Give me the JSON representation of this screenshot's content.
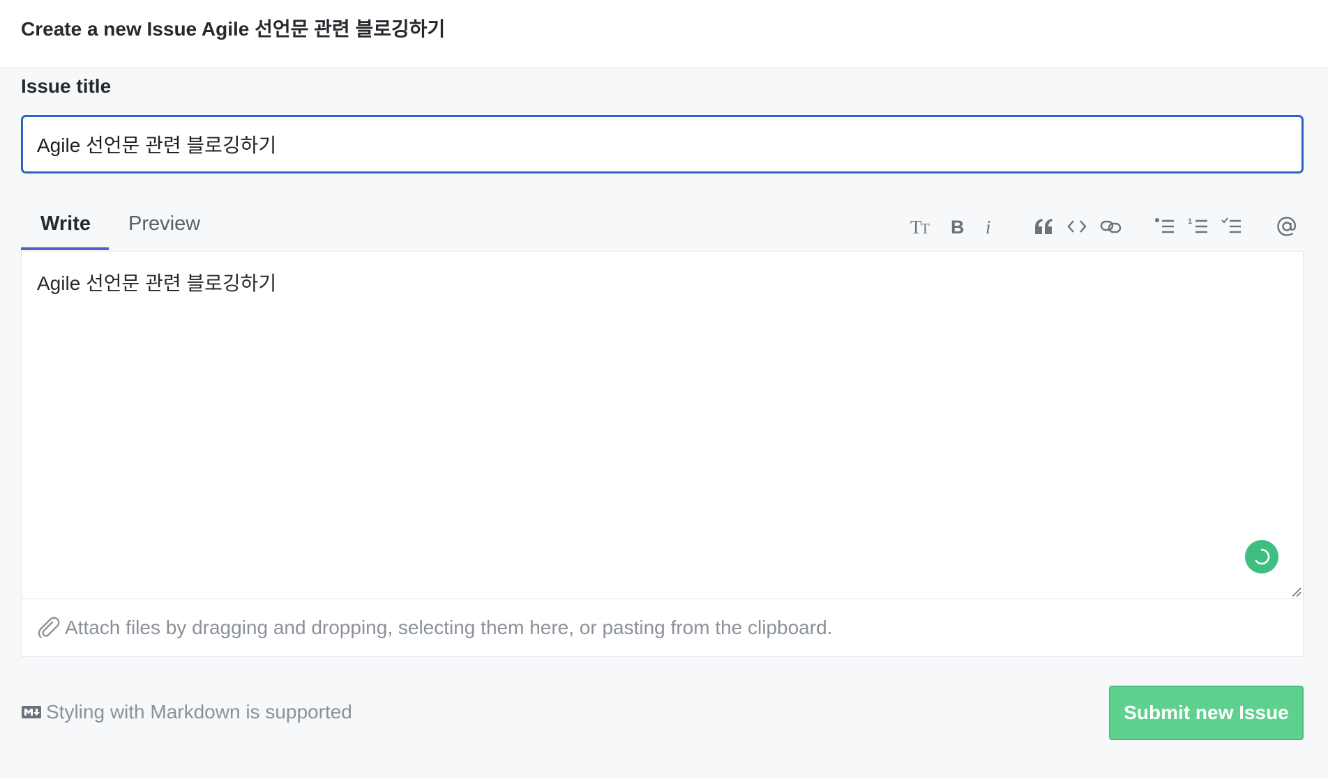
{
  "header": {
    "title": "Create a new Issue Agile 선언문 관련 블로깅하기"
  },
  "issue_title": {
    "label": "Issue title",
    "value": "Agile 선언문 관련 블로깅하기"
  },
  "tabs": [
    {
      "label": "Write",
      "active": true
    },
    {
      "label": "Preview",
      "active": false
    }
  ],
  "toolbar": {
    "icons": [
      "text-size-icon",
      "bold-icon",
      "italic-icon",
      "quote-icon",
      "code-icon",
      "link-icon",
      "bullet-list-icon",
      "numbered-list-icon",
      "task-list-icon",
      "mention-icon"
    ]
  },
  "editor": {
    "content": "Agile 선언문 관련 블로깅하기"
  },
  "attach": {
    "text": "Attach files by dragging and dropping, selecting them here, or pasting from the clipboard."
  },
  "footer": {
    "markdown_hint": "Styling with Markdown is supported",
    "submit_label": "Submit new Issue"
  },
  "colors": {
    "accent_blue": "#2b64c4",
    "submit_green": "#5fd18f",
    "spinner_green": "#3fbf7f",
    "tab_underline": "#4a64c9"
  }
}
